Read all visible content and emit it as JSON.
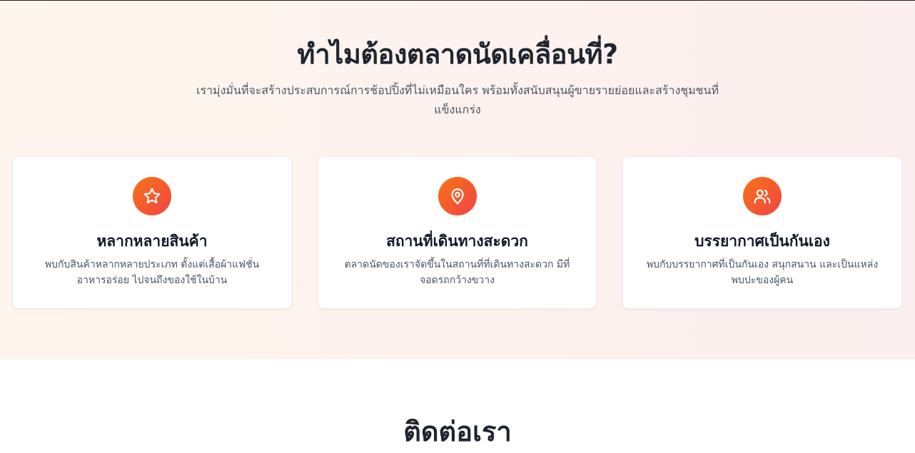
{
  "why": {
    "title": "ทำไมต้องตลาดนัดเคลื่อนที่?",
    "subtitle": "เรามุ่งมั่นที่จะสร้างประสบการณ์การช้อปปิ้งที่ไม่เหมือนใคร พร้อมทั้งสนับสนุนผู้ขายรายย่อยและสร้างชุมชนที่แข็งแกร่ง",
    "cards": [
      {
        "icon": "star-icon",
        "title": "หลากหลายสินค้า",
        "description": "พบกับสินค้าหลากหลายประเภท ตั้งแต่เสื้อผ้าแฟชั่น อาหารอร่อย ไปจนถึงของใช้ในบ้าน"
      },
      {
        "icon": "map-pin-icon",
        "title": "สถานที่เดินทางสะดวก",
        "description": "ตลาดนัดของเราจัดขึ้นในสถานที่ที่เดินทางสะดวก มีที่จอดรถกว้างขวาง"
      },
      {
        "icon": "users-icon",
        "title": "บรรยากาศเป็นกันเอง",
        "description": "พบกับบรรยากาศที่เป็นกันเอง สนุกสนาน และเป็นแหล่งพบปะของผู้คน"
      }
    ],
    "colors": {
      "icon_gradient_start": "#f97316",
      "icon_gradient_end": "#ef4444"
    }
  },
  "contact": {
    "title": "ติดต่อเรา"
  }
}
